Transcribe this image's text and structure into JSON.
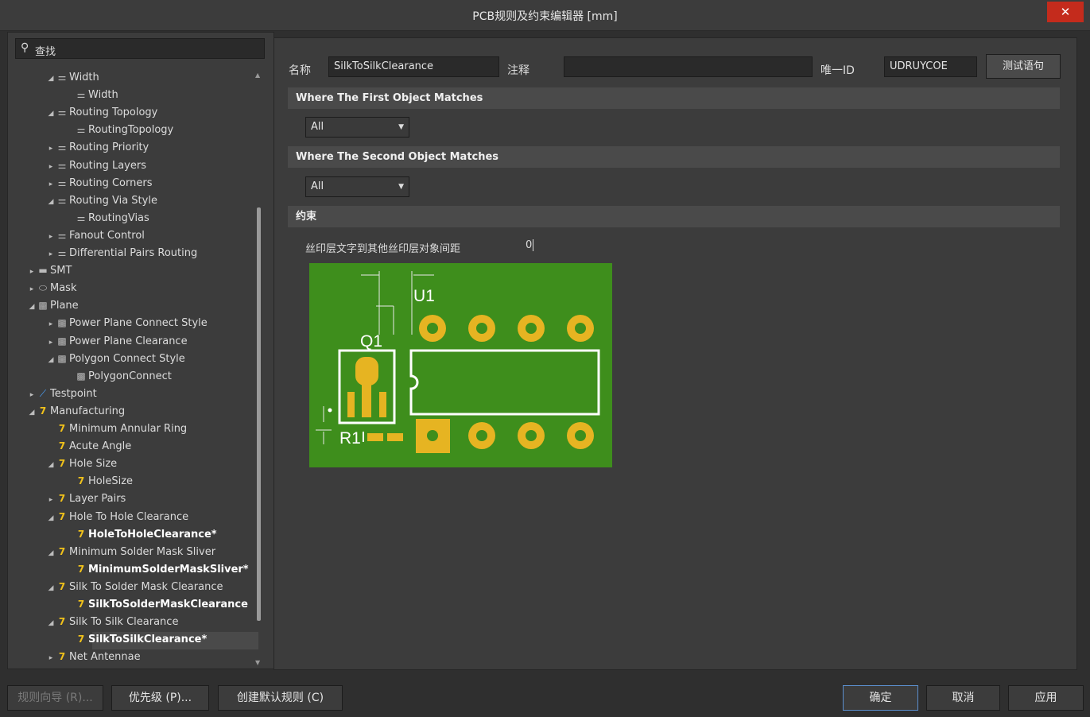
{
  "window": {
    "title": "PCB规则及约束编辑器 [mm]",
    "close_label": "✕"
  },
  "search": {
    "label": "查找"
  },
  "tree": [
    {
      "label": "Width",
      "arrow": "◢",
      "icon": "route-icon",
      "glyph": "⚌",
      "level": 2,
      "bold": false
    },
    {
      "label": "Width",
      "arrow": "",
      "icon": "route-icon",
      "glyph": "⚌",
      "level": 3,
      "bold": false
    },
    {
      "label": "Routing Topology",
      "arrow": "◢",
      "icon": "route-icon",
      "glyph": "⚌",
      "level": 2,
      "bold": false
    },
    {
      "label": "RoutingTopology",
      "arrow": "",
      "icon": "route-icon",
      "glyph": "⚌",
      "level": 3,
      "bold": false
    },
    {
      "label": "Routing Priority",
      "arrow": "▸",
      "icon": "route-icon",
      "glyph": "⚌",
      "level": 2,
      "bold": false
    },
    {
      "label": "Routing Layers",
      "arrow": "▸",
      "icon": "route-icon",
      "glyph": "⚌",
      "level": 2,
      "bold": false
    },
    {
      "label": "Routing Corners",
      "arrow": "▸",
      "icon": "route-icon",
      "glyph": "⚌",
      "level": 2,
      "bold": false
    },
    {
      "label": "Routing Via Style",
      "arrow": "◢",
      "icon": "route-icon",
      "glyph": "⚌",
      "level": 2,
      "bold": false
    },
    {
      "label": "RoutingVias",
      "arrow": "",
      "icon": "route-icon",
      "glyph": "⚌",
      "level": 3,
      "bold": false
    },
    {
      "label": "Fanout Control",
      "arrow": "▸",
      "icon": "route-icon",
      "glyph": "⚌",
      "level": 2,
      "bold": false
    },
    {
      "label": "Differential Pairs Routing",
      "arrow": "▸",
      "icon": "route-icon",
      "glyph": "⚌",
      "level": 2,
      "bold": false
    },
    {
      "label": "SMT",
      "arrow": "▸",
      "icon": "smt-icon",
      "glyph": "▬",
      "level": 1,
      "bold": false
    },
    {
      "label": "Mask",
      "arrow": "▸",
      "icon": "mask-icon",
      "glyph": "⬭",
      "level": 1,
      "bold": false
    },
    {
      "label": "Plane",
      "arrow": "◢",
      "icon": "plane-icon",
      "glyph": "▩",
      "level": 1,
      "bold": false
    },
    {
      "label": "Power Plane Connect Style",
      "arrow": "▸",
      "icon": "plane-icon",
      "glyph": "▩",
      "level": 2,
      "bold": false
    },
    {
      "label": "Power Plane Clearance",
      "arrow": "▸",
      "icon": "plane-icon",
      "glyph": "▩",
      "level": 2,
      "bold": false
    },
    {
      "label": "Polygon Connect Style",
      "arrow": "◢",
      "icon": "plane-icon",
      "glyph": "▩",
      "level": 2,
      "bold": false
    },
    {
      "label": "PolygonConnect",
      "arrow": "",
      "icon": "plane-icon",
      "glyph": "▩",
      "level": 3,
      "bold": false
    },
    {
      "label": "Testpoint",
      "arrow": "▸",
      "icon": "testpoint-icon",
      "glyph": "⟋",
      "level": 1,
      "bold": false
    },
    {
      "label": "Manufacturing",
      "arrow": "◢",
      "icon": "manufacturing-icon",
      "glyph": "7",
      "level": 1,
      "bold": false
    },
    {
      "label": "Minimum Annular Ring",
      "arrow": "",
      "icon": "manufacturing-icon",
      "glyph": "7",
      "level": 2,
      "bold": false
    },
    {
      "label": "Acute Angle",
      "arrow": "",
      "icon": "manufacturing-icon",
      "glyph": "7",
      "level": 2,
      "bold": false
    },
    {
      "label": "Hole Size",
      "arrow": "◢",
      "icon": "manufacturing-icon",
      "glyph": "7",
      "level": 2,
      "bold": false
    },
    {
      "label": "HoleSize",
      "arrow": "",
      "icon": "manufacturing-icon",
      "glyph": "7",
      "level": 3,
      "bold": false
    },
    {
      "label": "Layer Pairs",
      "arrow": "▸",
      "icon": "manufacturing-icon",
      "glyph": "7",
      "level": 2,
      "bold": false
    },
    {
      "label": "Hole To Hole Clearance",
      "arrow": "◢",
      "icon": "manufacturing-icon",
      "glyph": "7",
      "level": 2,
      "bold": false
    },
    {
      "label": "HoleToHoleClearance*",
      "arrow": "",
      "icon": "manufacturing-icon",
      "glyph": "7",
      "level": 3,
      "bold": true
    },
    {
      "label": "Minimum Solder Mask Sliver",
      "arrow": "◢",
      "icon": "manufacturing-icon",
      "glyph": "7",
      "level": 2,
      "bold": false
    },
    {
      "label": "MinimumSolderMaskSliver*",
      "arrow": "",
      "icon": "manufacturing-icon",
      "glyph": "7",
      "level": 3,
      "bold": true
    },
    {
      "label": "Silk To Solder Mask Clearance",
      "arrow": "◢",
      "icon": "manufacturing-icon",
      "glyph": "7",
      "level": 2,
      "bold": false
    },
    {
      "label": "SilkToSolderMaskClearance",
      "arrow": "",
      "icon": "manufacturing-icon",
      "glyph": "7",
      "level": 3,
      "bold": true
    },
    {
      "label": "Silk To Silk Clearance",
      "arrow": "◢",
      "icon": "manufacturing-icon",
      "glyph": "7",
      "level": 2,
      "bold": false
    },
    {
      "label": "SilkToSilkClearance*",
      "arrow": "",
      "icon": "manufacturing-icon",
      "glyph": "7",
      "level": 3,
      "bold": true,
      "selected": true
    },
    {
      "label": "Net Antennae",
      "arrow": "▸",
      "icon": "manufacturing-icon",
      "glyph": "7",
      "level": 2,
      "bold": false
    }
  ],
  "form": {
    "name_label": "名称",
    "name_value": "SilkToSilkClearance",
    "comment_label": "注释",
    "comment_value": "",
    "uid_label": "唯一ID",
    "uid_value": "UDRUYCOE",
    "test_button": "测试语句"
  },
  "sections": {
    "first_title": "Where The First Object Matches",
    "first_value": "All",
    "second_title": "Where The Second Object Matches",
    "second_value": "All",
    "constraint_title": "约束"
  },
  "constraint": {
    "label": "丝印层文字到其他丝印层对象间距",
    "value": "0"
  },
  "diagram": {
    "u1": "U1",
    "q1": "Q1",
    "r1": "R1",
    "board_color": "#3e8e1c",
    "pad_color": "#e6b422"
  },
  "buttons": {
    "wizard": "规则向导 (R)...",
    "priority": "优先级 (P)...",
    "create_default": "创建默认规则 (C)",
    "ok": "确定",
    "cancel": "取消",
    "apply": "应用"
  }
}
